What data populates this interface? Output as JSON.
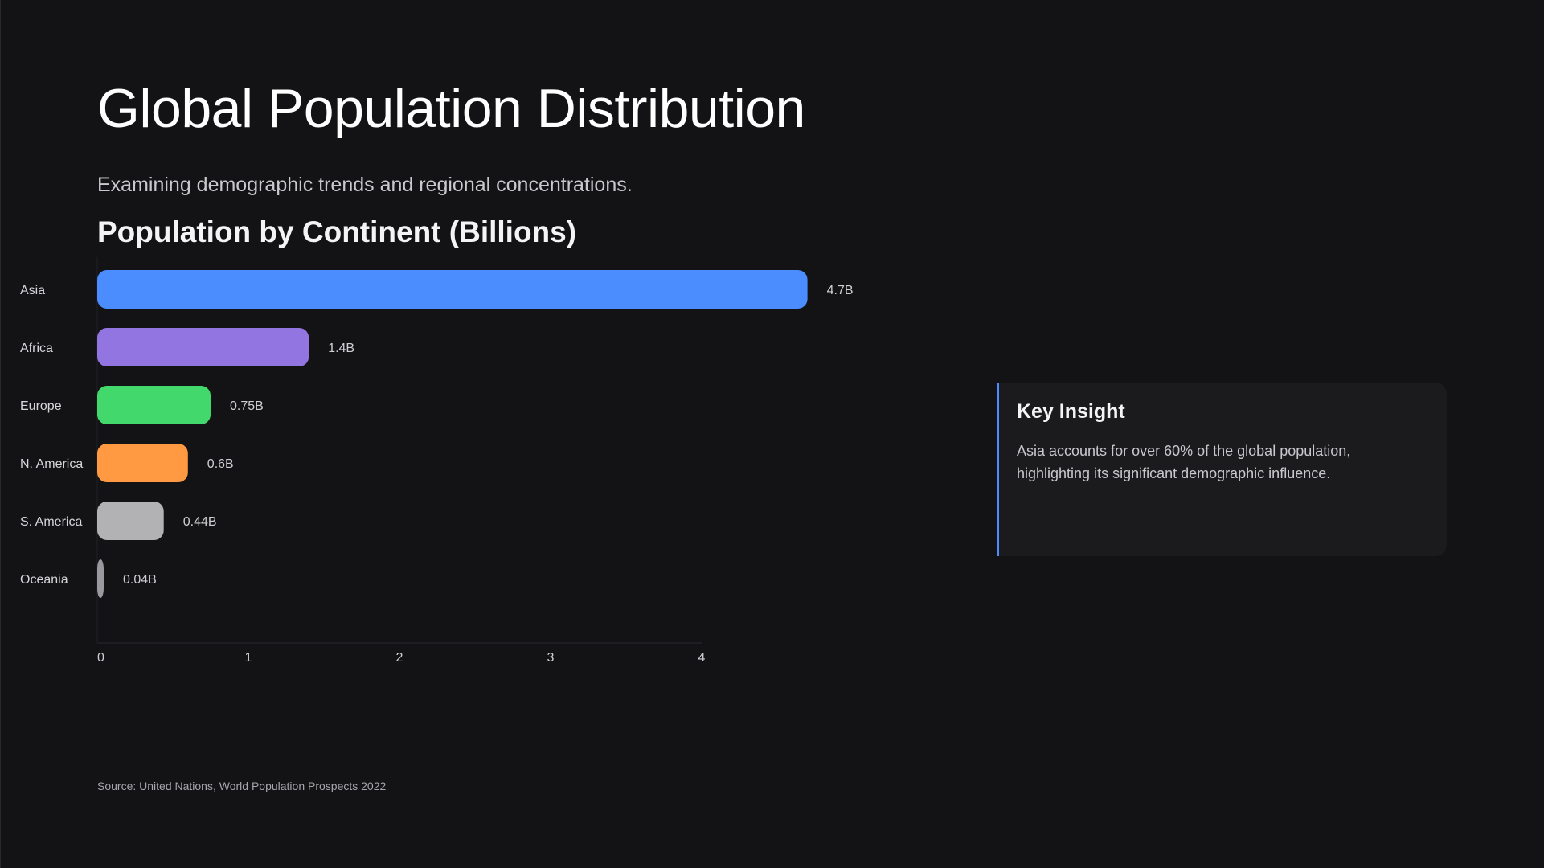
{
  "slide": {
    "title": "Global Population Distribution",
    "subtitle": "Examining demographic trends and regional concentrations.",
    "source": "Source: United Nations, World Population Prospects 2022"
  },
  "insight": {
    "title": "Key Insight",
    "body": "Asia accounts for over 60% of the global population, highlighting its significant demographic influence.",
    "accent_color": "#4b8cff"
  },
  "chart_data": {
    "type": "bar",
    "orientation": "horizontal",
    "title": "Population by Continent (Billions)",
    "categories": [
      "Asia",
      "Africa",
      "Europe",
      "N. America",
      "S. America",
      "Oceania"
    ],
    "values": [
      4.7,
      1.4,
      0.75,
      0.6,
      0.44,
      0.04
    ],
    "value_labels": [
      "4.7B",
      "1.4B",
      "0.75B",
      "0.6B",
      "0.44B",
      "0.04B"
    ],
    "colors": [
      "#4b8cff",
      "#9275e0",
      "#43d86b",
      "#ff9a42",
      "#b2b2b4",
      "#9a9a9e"
    ],
    "xlim": [
      0,
      5
    ],
    "xticks": [
      0,
      1,
      2,
      3,
      4
    ],
    "xlabel": "",
    "ylabel": "",
    "grid": false,
    "legend": "none"
  }
}
